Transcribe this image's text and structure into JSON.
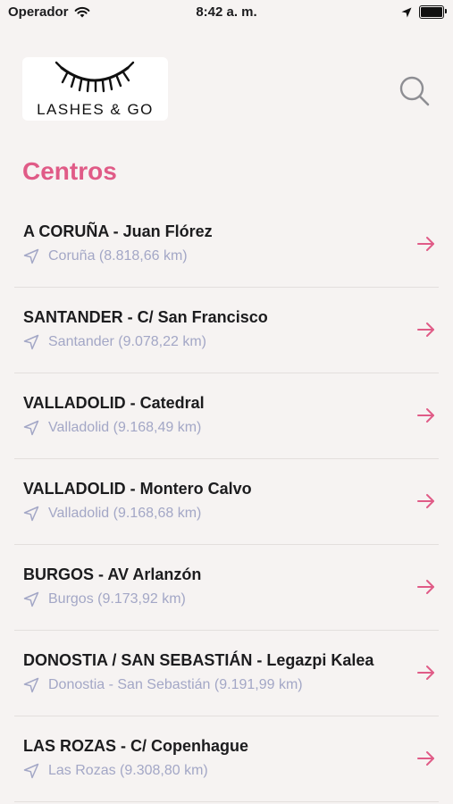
{
  "status_bar": {
    "carrier": "Operador",
    "time": "8:42 a. m.",
    "battery_level": 1.0
  },
  "header": {
    "logo_text": "LASHES & GO",
    "search_icon": "search-icon"
  },
  "title": "Centros",
  "colors": {
    "accent": "#e05b87",
    "subtitle": "#a3a7c6",
    "background": "#f6f3f2"
  },
  "centers": [
    {
      "name": "A CORUÑA - Juan Flórez",
      "distance": "Coruña (8.818,66 km)"
    },
    {
      "name": "SANTANDER - C/ San Francisco",
      "distance": "Santander (9.078,22 km)"
    },
    {
      "name": "VALLADOLID - Catedral",
      "distance": "Valladolid (9.168,49 km)"
    },
    {
      "name": "VALLADOLID - Montero Calvo",
      "distance": "Valladolid (9.168,68 km)"
    },
    {
      "name": "BURGOS - AV Arlanzón",
      "distance": "Burgos (9.173,92 km)"
    },
    {
      "name": "DONOSTIA / SAN SEBASTIÁN - Legazpi Kalea",
      "distance": "Donostia - San Sebastián (9.191,99 km)"
    },
    {
      "name": "LAS ROZAS - C/ Copenhague",
      "distance": "Las Rozas (9.308,80 km)"
    }
  ]
}
